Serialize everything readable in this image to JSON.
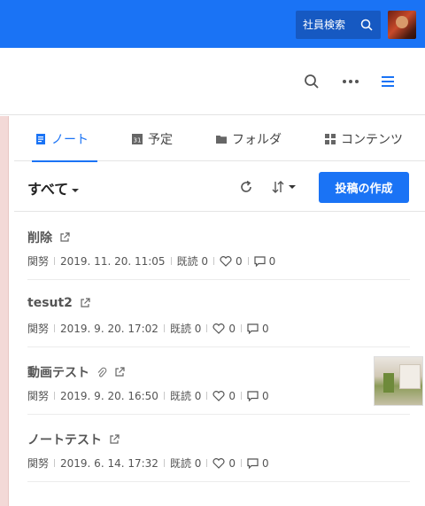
{
  "header": {
    "employee_search_label": "社員検索",
    "accent_color": "#1a73f5"
  },
  "tabs": [
    {
      "label": "ノート",
      "icon": "note-icon",
      "active": true
    },
    {
      "label": "予定",
      "icon": "calendar-icon",
      "calendar_day": "31",
      "active": false
    },
    {
      "label": "フォルダ",
      "icon": "folder-icon",
      "active": false
    },
    {
      "label": "コンテンツ",
      "icon": "grid-icon",
      "active": false
    }
  ],
  "toolbar": {
    "filter_label": "すべて",
    "create_button_label": "投稿の作成"
  },
  "posts": [
    {
      "title": "削除",
      "author": "関努",
      "date": "2019. 11. 20. 11:05",
      "read": "既読 0",
      "likes": "0",
      "comments": "0",
      "has_attachment": false,
      "has_thumbnail": false
    },
    {
      "title": "tesut2",
      "author": "関努",
      "date": "2019. 9. 20. 17:02",
      "read": "既読 0",
      "likes": "0",
      "comments": "0",
      "has_attachment": false,
      "has_thumbnail": false
    },
    {
      "title": "動画テスト",
      "author": "関努",
      "date": "2019. 9. 20. 16:50",
      "read": "既読 0",
      "likes": "0",
      "comments": "0",
      "has_attachment": true,
      "has_thumbnail": true
    },
    {
      "title": "ノートテスト",
      "author": "関努",
      "date": "2019. 6. 14. 17:32",
      "read": "既読 0",
      "likes": "0",
      "comments": "0",
      "has_attachment": false,
      "has_thumbnail": false
    }
  ]
}
